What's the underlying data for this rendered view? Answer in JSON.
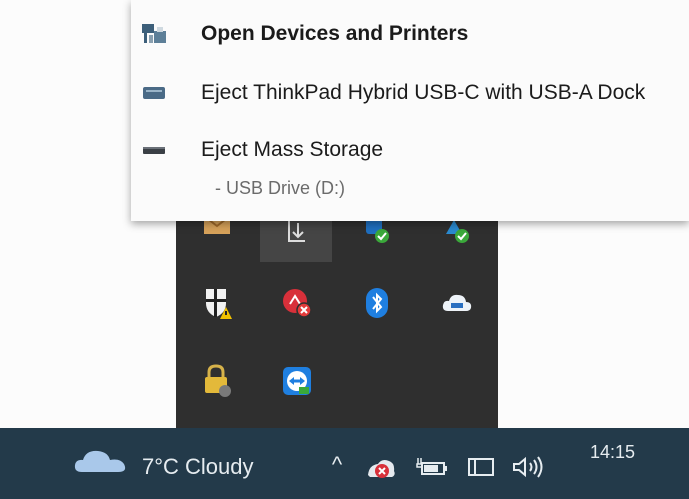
{
  "menu": {
    "open_devices": "Open Devices and Printers",
    "eject_dock": "Eject ThinkPad Hybrid USB-C with USB-A Dock",
    "eject_storage": "Eject Mass Storage",
    "storage_sub": "-  USB Drive (D:)"
  },
  "tray_icons": [
    "mail-icon",
    "download-icon",
    "network-check-icon",
    "network-sync-icon",
    "security-warning-icon",
    "error-x-icon",
    "bluetooth-icon",
    "cloud-app-icon",
    "vpn-lock-icon",
    "teamviewer-icon"
  ],
  "taskbar": {
    "weather": "7°C  Cloudy",
    "show_hidden": "^",
    "clock": "14:15"
  },
  "colors": {
    "taskbar": "#233a4a",
    "flyout": "#2f2f2f",
    "accent_blue": "#1f7fe0",
    "error_red": "#e23a3a"
  }
}
